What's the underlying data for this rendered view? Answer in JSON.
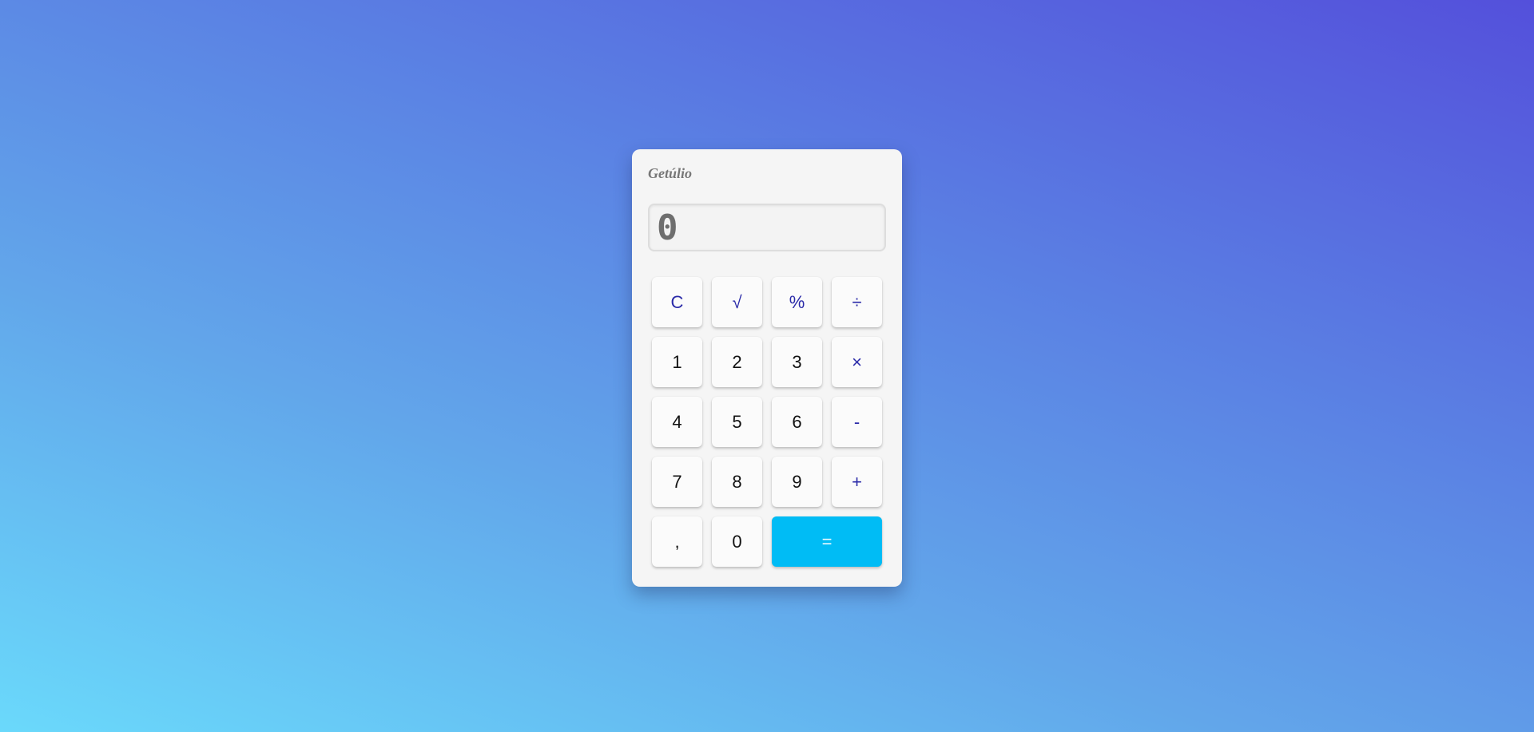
{
  "calculator": {
    "brand": "Getúlio",
    "display": "0",
    "keys": [
      {
        "label": "C",
        "type": "op"
      },
      {
        "label": "√",
        "type": "op"
      },
      {
        "label": "%",
        "type": "op"
      },
      {
        "label": "÷",
        "type": "op"
      },
      {
        "label": "1",
        "type": "num"
      },
      {
        "label": "2",
        "type": "num"
      },
      {
        "label": "3",
        "type": "num"
      },
      {
        "label": "×",
        "type": "op"
      },
      {
        "label": "4",
        "type": "num"
      },
      {
        "label": "5",
        "type": "num"
      },
      {
        "label": "6",
        "type": "num"
      },
      {
        "label": "-",
        "type": "op"
      },
      {
        "label": "7",
        "type": "num"
      },
      {
        "label": "8",
        "type": "num"
      },
      {
        "label": "9",
        "type": "num"
      },
      {
        "label": "+",
        "type": "op"
      },
      {
        "label": ",",
        "type": "num"
      },
      {
        "label": "0",
        "type": "num"
      },
      {
        "label": "=",
        "type": "equals"
      }
    ]
  },
  "colors": {
    "equals_button": "#00bcf5",
    "operator_text": "#2a2aa8",
    "background_start": "#6ad9fb",
    "background_end": "#5450db"
  }
}
